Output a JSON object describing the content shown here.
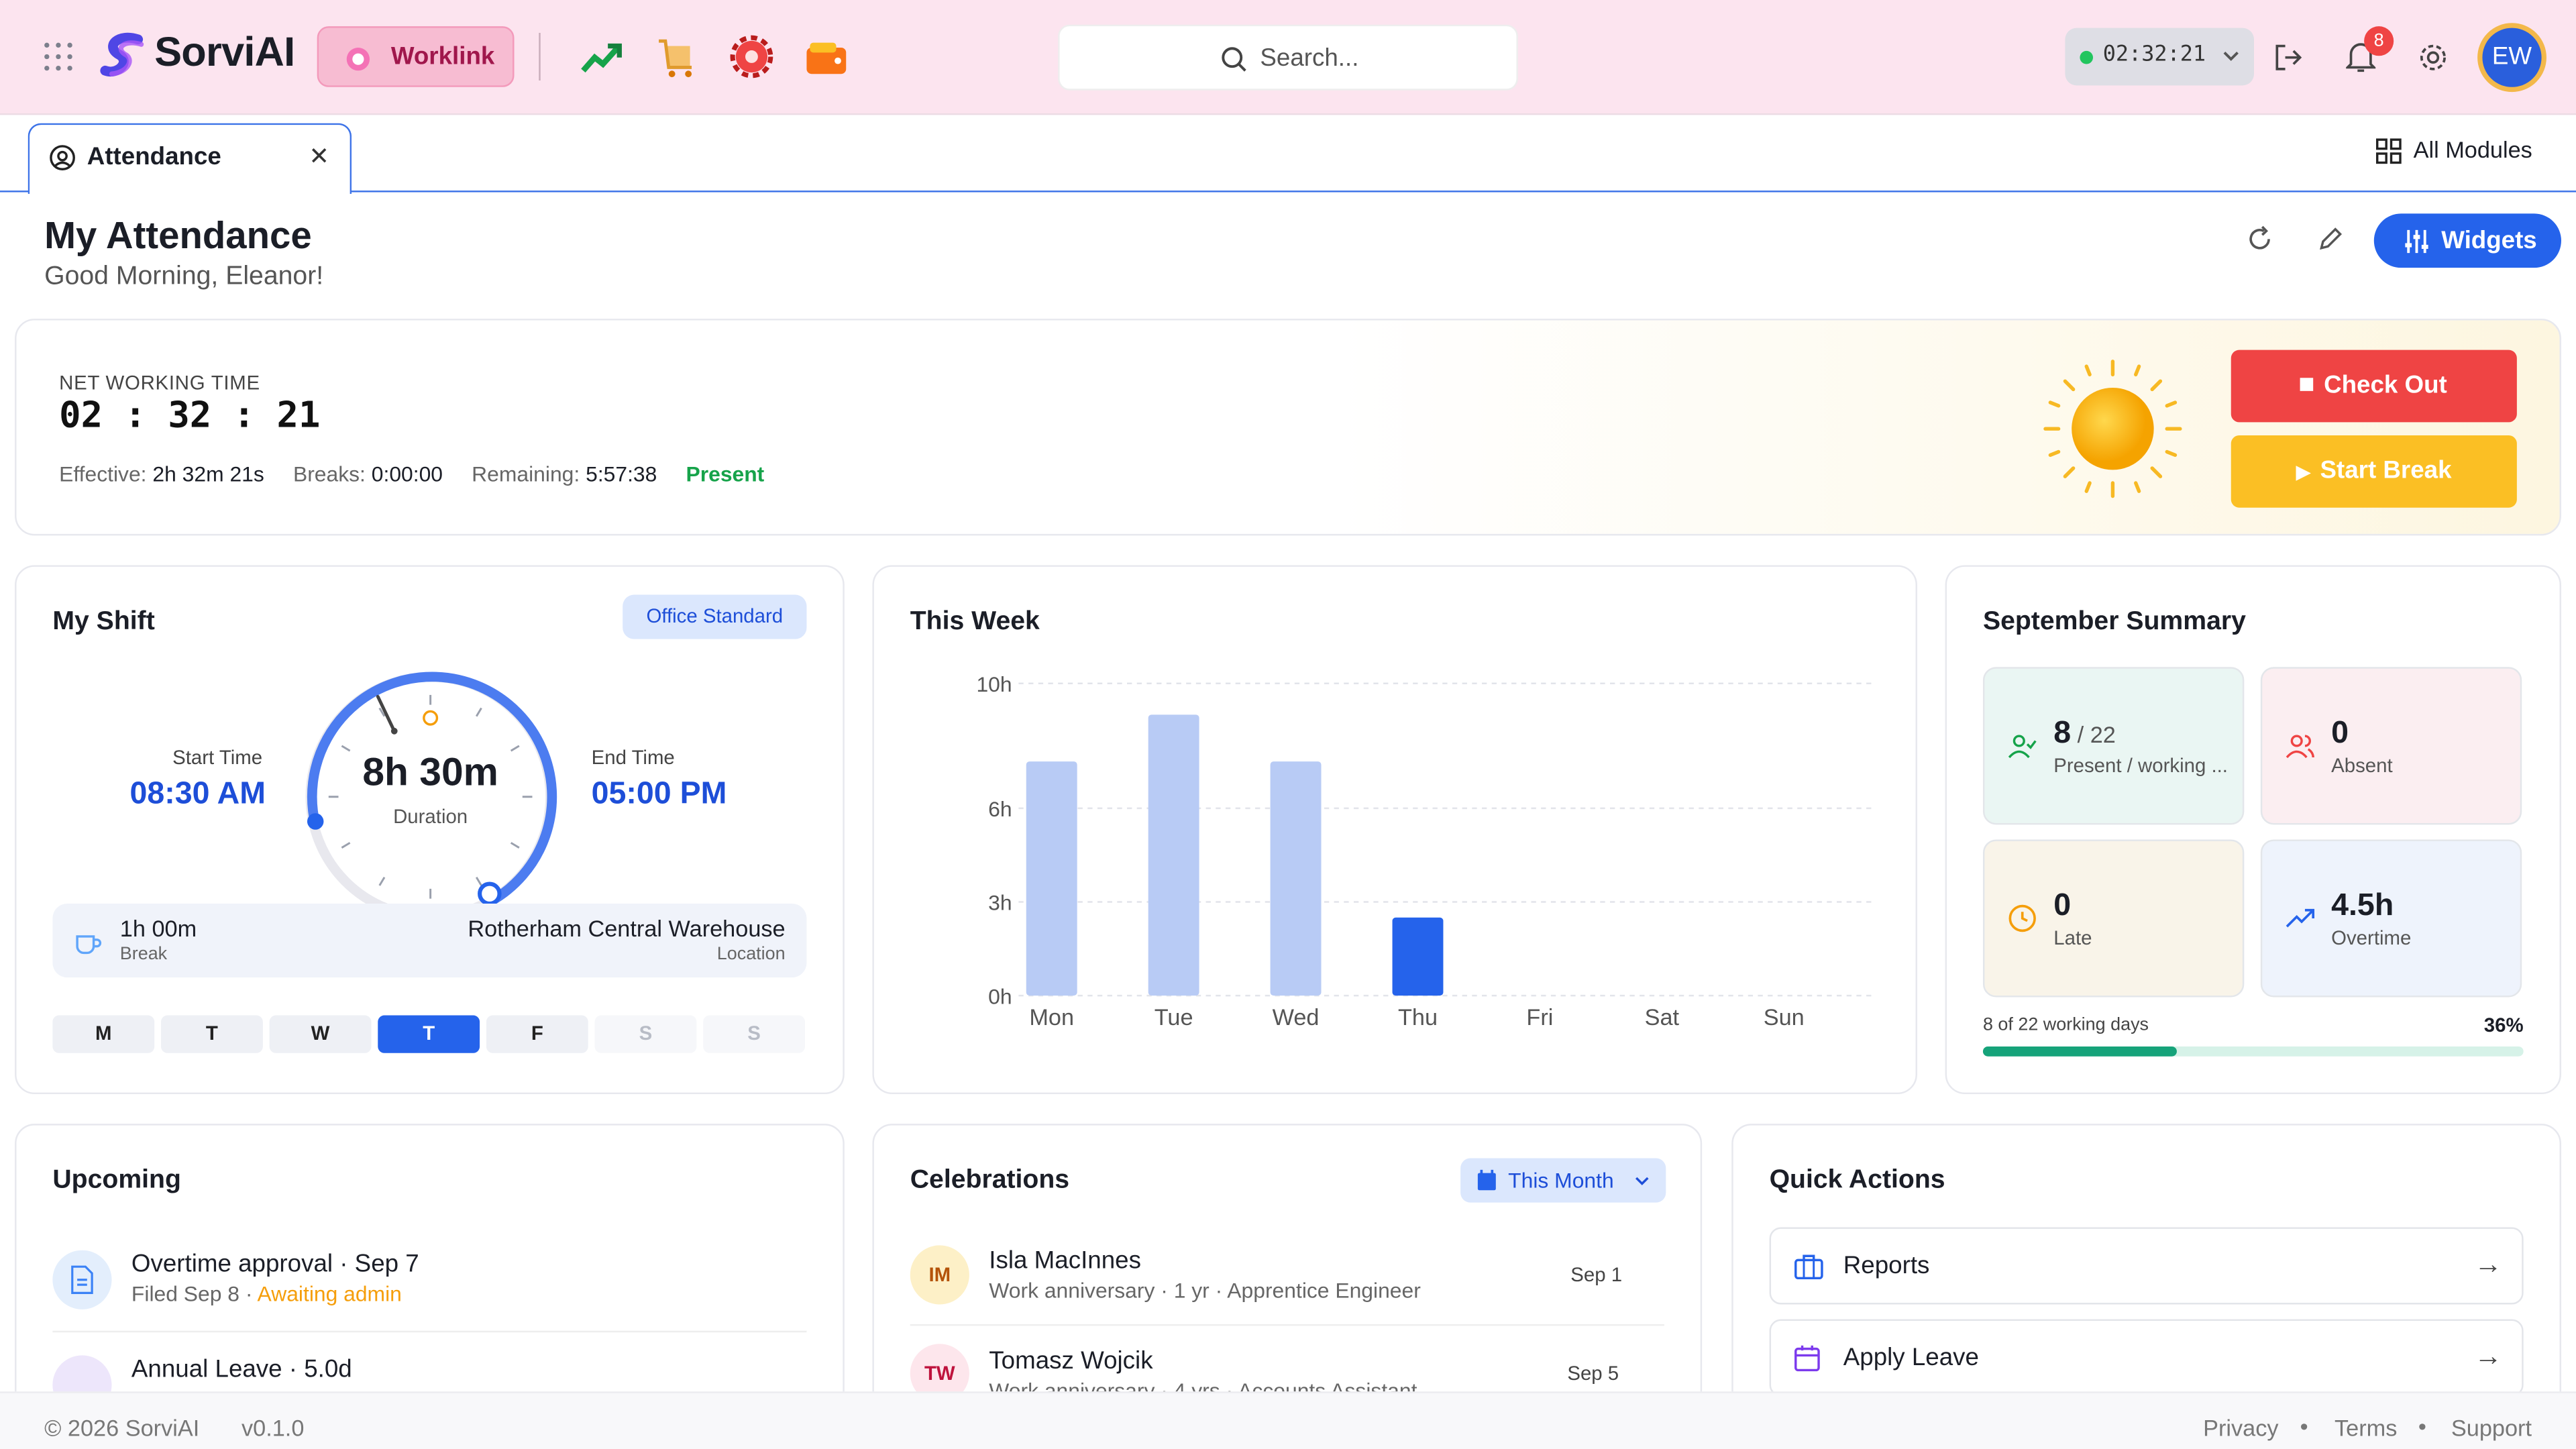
{
  "header": {
    "brand": "SorviAI",
    "worklink": "Worklink",
    "search_placeholder": "Search...",
    "timer": "02:32:21",
    "notif_count": "8",
    "avatar": "EW",
    "app_icons": [
      "trend-app-icon",
      "cart-app-icon",
      "gear-app-icon",
      "wallet-app-icon"
    ]
  },
  "tabs": {
    "active": "Attendance",
    "all_modules": "All Modules"
  },
  "page": {
    "title": "My Attendance",
    "greeting": "Good Morning, Eleanor!",
    "widgets": "Widgets"
  },
  "working": {
    "label": "NET WORKING TIME",
    "time": "02 : 32 : 21",
    "effective_label": "Effective:",
    "effective": "2h 32m 21s",
    "breaks_label": "Breaks:",
    "breaks": "0:00:00",
    "remaining_label": "Remaining:",
    "remaining": "5:57:38",
    "status": "Present",
    "check_out": "Check Out",
    "start_break": "Start Break"
  },
  "shift": {
    "title": "My Shift",
    "badge": "Office Standard",
    "start_label": "Start Time",
    "start": "08:30 AM",
    "end_label": "End Time",
    "end": "05:00 PM",
    "duration": "8h 30m",
    "duration_label": "Duration",
    "break": "1h 00m",
    "break_label": "Break",
    "location": "Rotherham Central Warehouse",
    "location_label": "Location",
    "days": [
      "M",
      "T",
      "W",
      "T",
      "F",
      "S",
      "S"
    ],
    "active_day": 3
  },
  "week": {
    "title": "This Week"
  },
  "chart_data": {
    "type": "bar",
    "categories": [
      "Mon",
      "Tue",
      "Wed",
      "Thu",
      "Fri",
      "Sat",
      "Sun"
    ],
    "values": [
      7.5,
      9,
      7.5,
      2.5,
      0,
      0,
      0
    ],
    "highlight": "Thu",
    "yticks": [
      "0h",
      "3h",
      "6h",
      "10h"
    ],
    "ylim": [
      0,
      10
    ],
    "colors": {
      "past": "#b8cbf5",
      "today": "#2563eb"
    },
    "grid": true,
    "title": "This Week"
  },
  "summary": {
    "title": "September Summary",
    "present": "8",
    "present_total": "/ 22",
    "present_label": "Present / working ...",
    "absent": "0",
    "absent_label": "Absent",
    "late": "0",
    "late_label": "Late",
    "overtime": "4.5h",
    "overtime_label": "Overtime",
    "progress_label": "8 of 22 working days",
    "progress_pct": "36%",
    "progress_value": 0.36
  },
  "upcoming": {
    "title": "Upcoming",
    "items": [
      {
        "title": "Overtime approval · Sep 7",
        "sub": "Filed Sep 8 ·",
        "status": "Awaiting admin"
      },
      {
        "title": "Annual Leave · 5.0d",
        "sub": "",
        "status": ""
      }
    ]
  },
  "celebrations": {
    "title": "Celebrations",
    "filter": "This Month",
    "items": [
      {
        "initials": "IM",
        "name": "Isla MacInnes",
        "sub": "Work anniversary · 1 yr · Apprentice Engineer",
        "date": "Sep 1"
      },
      {
        "initials": "TW",
        "name": "Tomasz Wojcik",
        "sub": "Work anniversary · 4 yrs · Accounts Assistant",
        "date": "Sep 5"
      }
    ]
  },
  "quick": {
    "title": "Quick Actions",
    "items": [
      "Reports",
      "Apply Leave"
    ]
  },
  "footer": {
    "copyright": "© 2026 SorviAI",
    "version": "v0.1.0",
    "links": [
      "Privacy",
      "Terms",
      "Support"
    ]
  }
}
